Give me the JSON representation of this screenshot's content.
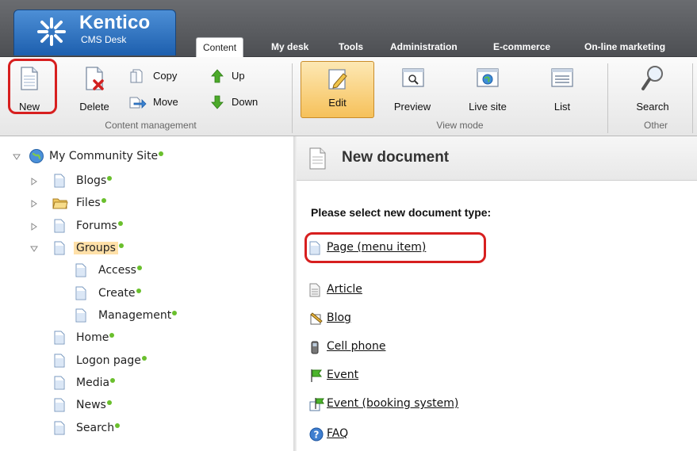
{
  "app": {
    "brand": "Kentico",
    "subtitle": "CMS Desk"
  },
  "tabs": [
    {
      "label": "Content",
      "active": true
    },
    {
      "label": "My desk"
    },
    {
      "label": "Tools"
    },
    {
      "label": "Administration"
    },
    {
      "label": "E-commerce"
    },
    {
      "label": "On-line marketing"
    }
  ],
  "ribbon": {
    "content_management": {
      "label": "Content management",
      "new": "New",
      "delete": "Delete",
      "copy": "Copy",
      "move": "Move",
      "up": "Up",
      "down": "Down"
    },
    "view_mode": {
      "label": "View mode",
      "edit": "Edit",
      "preview": "Preview",
      "live_site": "Live site",
      "list": "List"
    },
    "other": {
      "label": "Other",
      "search": "Search"
    }
  },
  "tree": {
    "root": "My Community Site",
    "nodes": [
      {
        "label": "Blogs",
        "icon": "page-icon"
      },
      {
        "label": "Files",
        "icon": "folder-icon"
      },
      {
        "label": "Forums",
        "icon": "page-icon"
      },
      {
        "label": "Groups",
        "icon": "page-icon",
        "selected": true
      },
      {
        "label": "Access",
        "icon": "page-icon"
      },
      {
        "label": "Create",
        "icon": "page-icon"
      },
      {
        "label": "Management",
        "icon": "page-icon"
      },
      {
        "label": "Home",
        "icon": "page-icon"
      },
      {
        "label": "Logon page",
        "icon": "page-icon"
      },
      {
        "label": "Media",
        "icon": "page-icon"
      },
      {
        "label": "News",
        "icon": "page-icon"
      },
      {
        "label": "Search",
        "icon": "page-icon"
      }
    ]
  },
  "content": {
    "title": "New document",
    "prompt": "Please select new document type:",
    "document_types": [
      {
        "label": "Page (menu item)",
        "icon": "page-icon"
      },
      {
        "label": "Article",
        "icon": "article-icon"
      },
      {
        "label": "Blog",
        "icon": "blog-icon"
      },
      {
        "label": "Cell phone",
        "icon": "cell-phone-icon"
      },
      {
        "label": "Event",
        "icon": "event-flag-icon"
      },
      {
        "label": "Event (booking system)",
        "icon": "event-booking-icon"
      },
      {
        "label": "FAQ",
        "icon": "faq-icon"
      }
    ]
  },
  "colors": {
    "highlight": "#d71f1f",
    "selection": "#ffe0a8",
    "status_dot": "#6abf2d",
    "logo": "#2a6fc0"
  }
}
